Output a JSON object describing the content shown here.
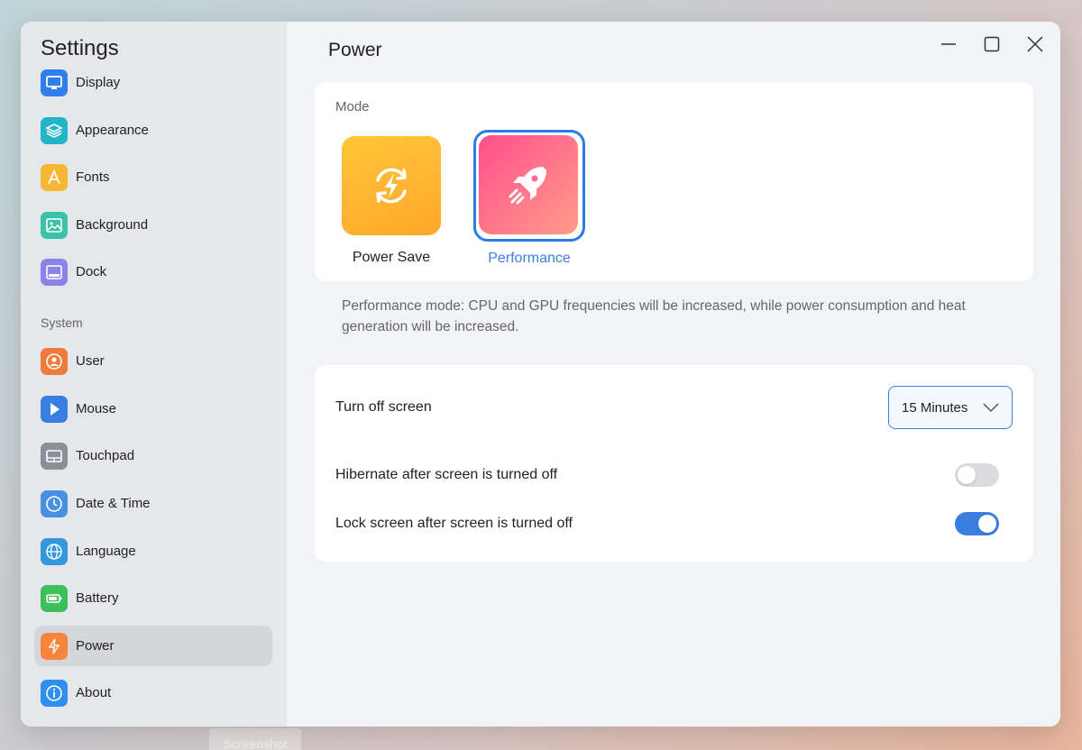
{
  "window": {
    "sidebar_title": "Settings",
    "page_title": "Power"
  },
  "sidebar": {
    "items": [
      {
        "label": "Display",
        "icon": "monitor-icon",
        "color": "#2f80ed"
      },
      {
        "label": "Appearance",
        "icon": "layers-icon",
        "color": "#22b5c7"
      },
      {
        "label": "Fonts",
        "icon": "font-icon",
        "color": "#f7b733"
      },
      {
        "label": "Background",
        "icon": "image-icon",
        "color": "#3cc2a8"
      },
      {
        "label": "Dock",
        "icon": "dock-icon",
        "color": "#8b84e8"
      }
    ],
    "section_label": "System",
    "system_items": [
      {
        "label": "User",
        "icon": "user-icon",
        "color": "#f07a3c"
      },
      {
        "label": "Mouse",
        "icon": "cursor-icon",
        "color": "#3a7fe0"
      },
      {
        "label": "Touchpad",
        "icon": "touchpad-icon",
        "color": "#8a8f98"
      },
      {
        "label": "Date & Time",
        "icon": "clock-icon",
        "color": "#4a90e2"
      },
      {
        "label": "Language",
        "icon": "globe-icon",
        "color": "#3498db"
      },
      {
        "label": "Battery",
        "icon": "battery-icon",
        "color": "#3cc15a"
      },
      {
        "label": "Power",
        "icon": "lightning-icon",
        "color": "#f7843c",
        "active": true
      },
      {
        "label": "About",
        "icon": "info-icon",
        "color": "#2f8ff0"
      }
    ]
  },
  "mode": {
    "title": "Mode",
    "options": [
      {
        "label": "Power Save",
        "icon": "power-save-icon"
      },
      {
        "label": "Performance",
        "icon": "rocket-icon",
        "selected": true
      }
    ],
    "description": "Performance mode: CPU and GPU frequencies will be increased, while power consumption and heat generation will be increased."
  },
  "settings": {
    "turn_off_screen_label": "Turn off screen",
    "turn_off_screen_value": "15 Minutes",
    "hibernate_label": "Hibernate after screen is turned off",
    "hibernate_on": false,
    "lock_label": "Lock screen after screen is turned off",
    "lock_on": true
  },
  "background_label": "Screenshot",
  "colors": {
    "accent": "#3a7fe0",
    "power_save_gradient": [
      "#ffc53a",
      "#ffa82b"
    ],
    "performance_gradient": [
      "#ff4f8a",
      "#ff9c8a"
    ]
  }
}
